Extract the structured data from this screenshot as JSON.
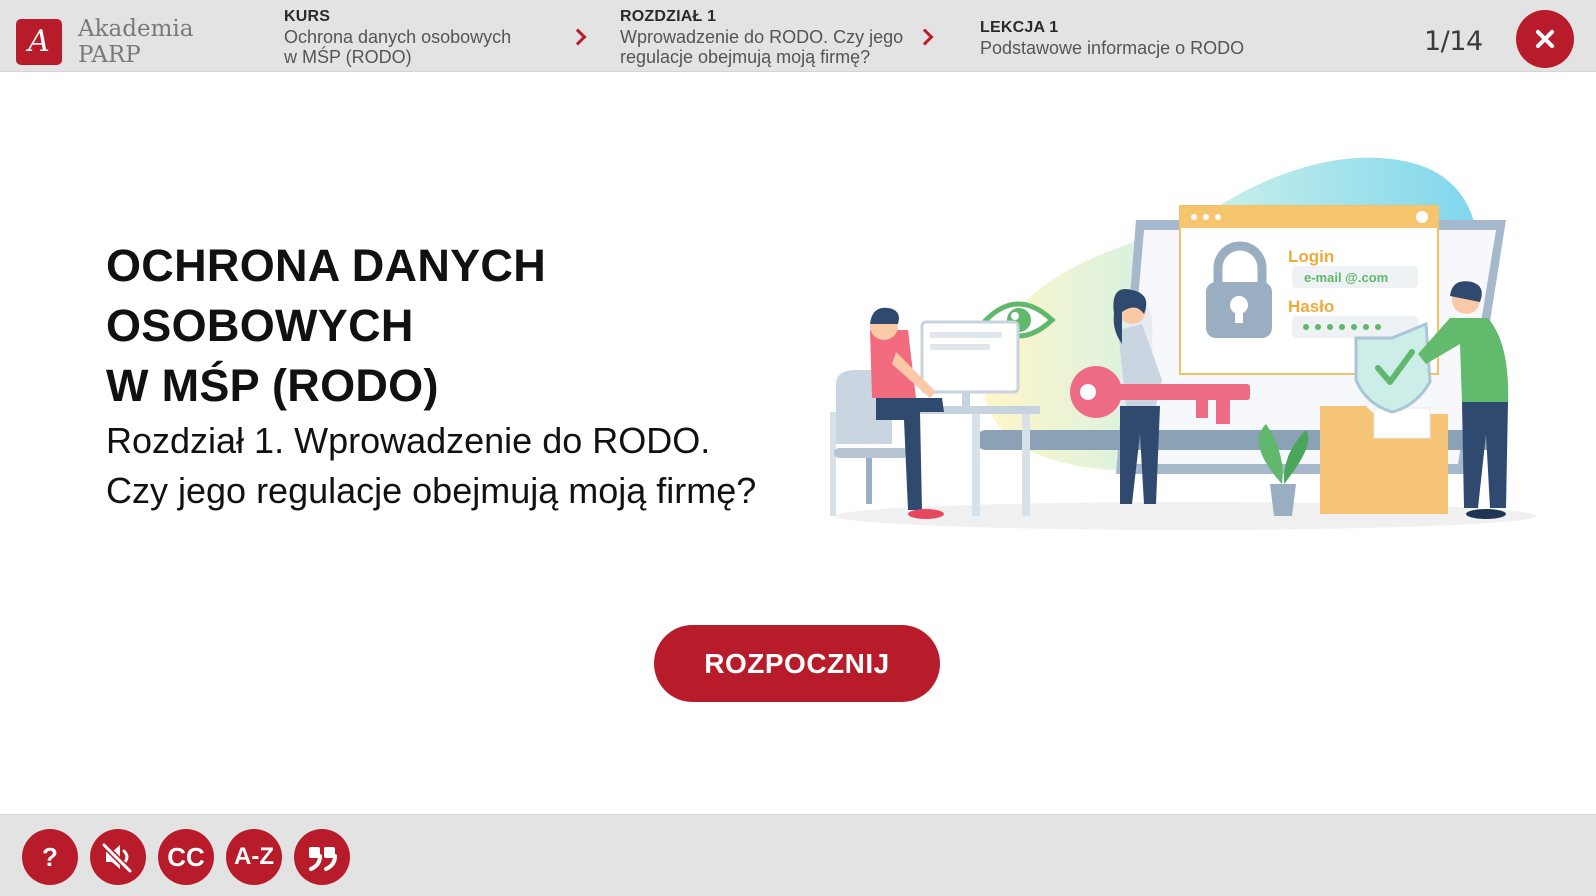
{
  "header": {
    "logo_line1": "Akademia",
    "logo_line2": "PARP",
    "course": {
      "label": "KURS",
      "line1": "Ochrona danych osobowych",
      "line2": "w MŚP (RODO)"
    },
    "chapter": {
      "label": "ROZDZIAŁ 1",
      "line1": "Wprowadzenie do RODO. Czy jego",
      "line2": "regulacje obejmują moją firmę?"
    },
    "lesson": {
      "label": "LEKCJA 1",
      "text": "Podstawowe informacje o RODO"
    },
    "page_counter": "1/14"
  },
  "main": {
    "title_line1": "OCHRONA DANYCH OSOBOWYCH",
    "title_line2": "W MŚP (RODO)",
    "subtitle_line1": "Rozdział 1. Wprowadzenie do RODO.",
    "subtitle_line2": "Czy jego regulacje obejmują moją firmę?",
    "start_button": "ROZPOCZNIJ",
    "illustration": {
      "login_label": "Login",
      "email_placeholder": "e-mail @.com",
      "password_label": "Hasło"
    }
  },
  "footer": {
    "tools": [
      {
        "name": "help",
        "label": "?"
      },
      {
        "name": "mute",
        "label": ""
      },
      {
        "name": "captions",
        "label": "CC"
      },
      {
        "name": "glossary",
        "label": "A-Z"
      },
      {
        "name": "quotes",
        "label": ""
      }
    ]
  },
  "colors": {
    "accent": "#b81c2b",
    "bar": "#e3e3e3"
  }
}
